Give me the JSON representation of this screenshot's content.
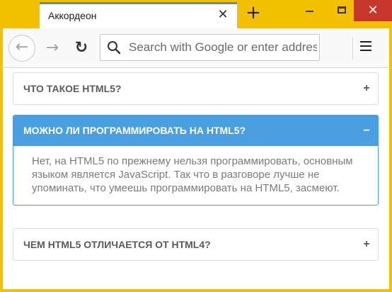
{
  "browser": {
    "tab_title": "Аккордеон",
    "tab_close_glyph": "✕",
    "new_tab_glyph": "+",
    "window_close_glyph": "✕",
    "back_glyph": "←",
    "forward_glyph": "→",
    "reload_glyph": "↻",
    "url_placeholder": "Search with Google or enter address",
    "url_value": ""
  },
  "accordion": {
    "items": [
      {
        "title": "ЧТО ТАКОЕ HTML5?",
        "sign": "+",
        "open": false
      },
      {
        "title": "МОЖНО ЛИ ПРОГРАММИРОВАТЬ НА HTML5?",
        "sign": "−",
        "open": true,
        "body": "Нет, на HTML5 по прежнему нельзя программировать, основным языком является JavaScript. Так что в разговоре лучше не упоминать, что умеешь программировать на HTML5, засмеют."
      },
      {
        "title": "ЧЕМ HTML5 ОТЛИЧАЕТСЯ ОТ HTML4?",
        "sign": "+",
        "open": false
      }
    ]
  },
  "colors": {
    "frame": "#f2c000",
    "accent": "#4a9fe1",
    "close_button": "#c7372b"
  }
}
